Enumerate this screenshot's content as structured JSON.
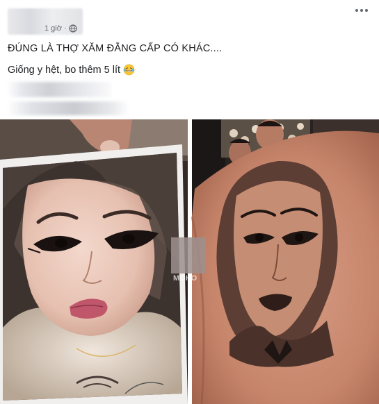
{
  "post": {
    "time_label": "1 giờ",
    "text_line1": "ĐÚNG LÀ THỢ XĂM ĐẲNG CẤP CÓ KHÁC....",
    "text_line2": "Giống y hệt, bo thêm 5 lít",
    "emoji": "laughing-tears-emoji",
    "icons": {
      "privacy": "globe-icon",
      "options": "more-options-icon"
    }
  },
  "photo": {
    "watermark_text": "MOHO"
  }
}
